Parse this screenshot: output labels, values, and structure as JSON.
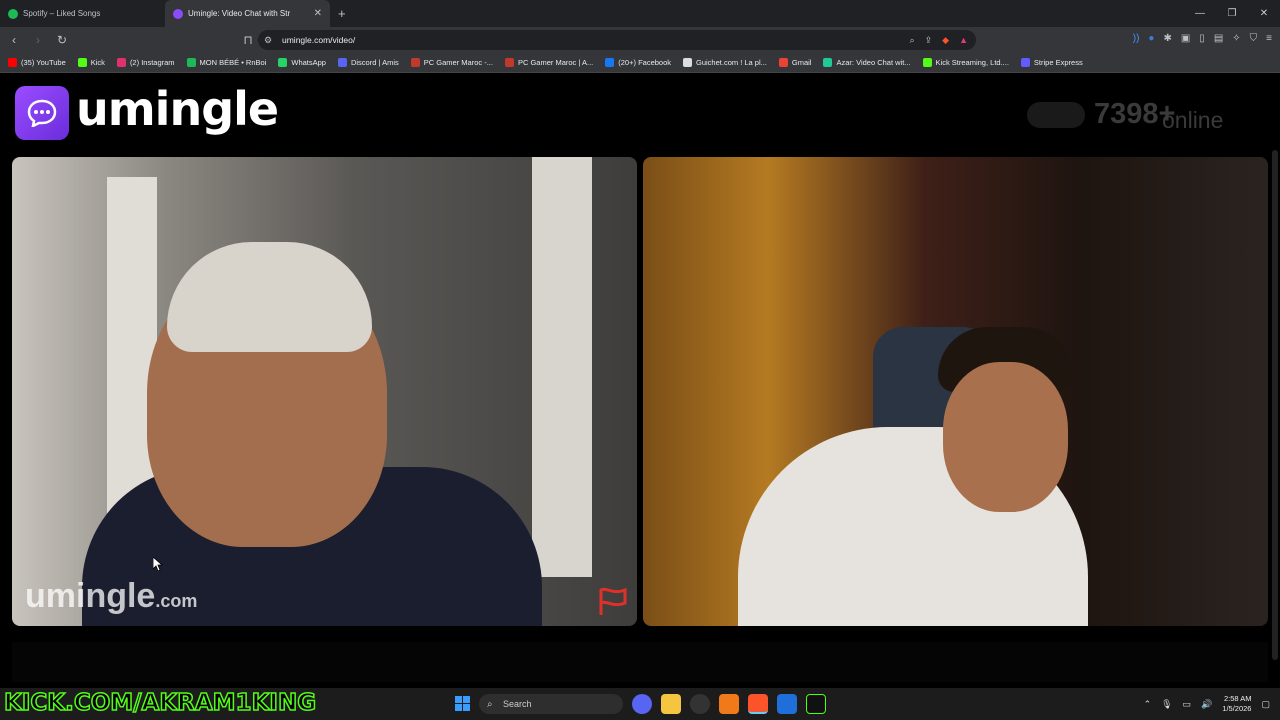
{
  "browser": {
    "tabs": [
      {
        "title": "Spotify – Liked Songs",
        "favicon_color": "#1db954"
      },
      {
        "title": "Umingle: Video Chat with Str",
        "favicon_color": "#8b4cf7"
      }
    ],
    "url": "umingle.com/video/",
    "bookmarks": [
      {
        "label": "(35) YouTube",
        "color": "#ff0000"
      },
      {
        "label": "Kick",
        "color": "#53fc18"
      },
      {
        "label": "(2) Instagram",
        "color": "#e1306c"
      },
      {
        "label": "MON BÉBÉ • RnBoi",
        "color": "#1db954"
      },
      {
        "label": "WhatsApp",
        "color": "#25d366"
      },
      {
        "label": "Discord | Amis",
        "color": "#5865f2"
      },
      {
        "label": "PC Gamer Maroc -...",
        "color": "#c0392b"
      },
      {
        "label": "PC Gamer Maroc | A...",
        "color": "#c0392b"
      },
      {
        "label": "(20+) Facebook",
        "color": "#1877f2"
      },
      {
        "label": "Guichet.com ! La pl...",
        "color": "#dddddd"
      },
      {
        "label": "Gmail",
        "color": "#ea4335"
      },
      {
        "label": "Azar: Video Chat wit...",
        "color": "#20c997"
      },
      {
        "label": "Kick Streaming, Ltd....",
        "color": "#53fc18"
      },
      {
        "label": "Stripe Express",
        "color": "#635bff"
      }
    ]
  },
  "app": {
    "logo_text": "umingle",
    "online_count": "7398+",
    "online_label": "online",
    "brand_color": "#8b4cf7"
  },
  "video": {
    "watermark_main": "umingle",
    "watermark_suffix": ".com"
  },
  "overlay": {
    "stream_text": "KICK.COM/AKRAM1KING"
  },
  "taskbar": {
    "search_placeholder": "Search",
    "time": "2:58 AM",
    "date": "1/5/2026"
  }
}
